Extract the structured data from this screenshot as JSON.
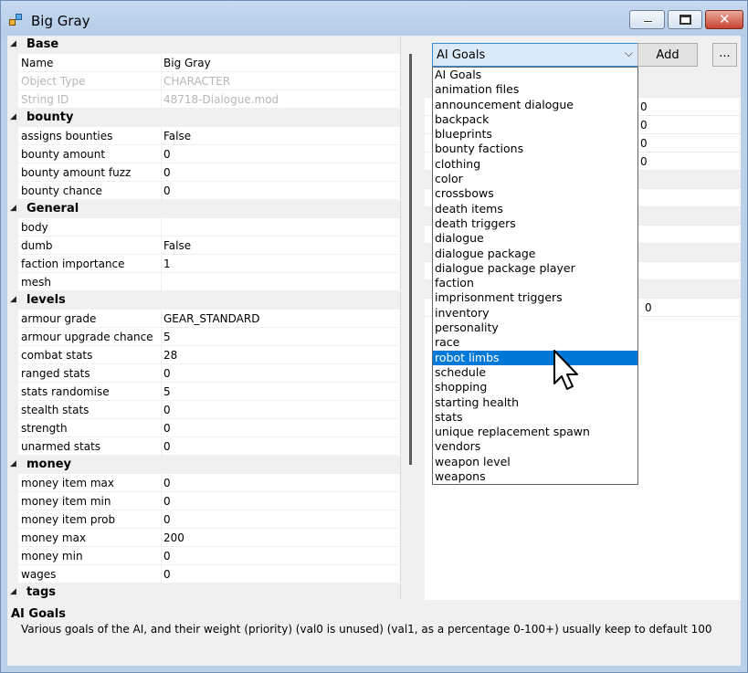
{
  "window": {
    "title": "Big Gray",
    "icon": "app-object-icon"
  },
  "grid": {
    "groups": [
      {
        "name": "Base",
        "props": [
          {
            "name": "Name",
            "value": "Big Gray",
            "disabled": false
          },
          {
            "name": "Object Type",
            "value": "CHARACTER",
            "disabled": true
          },
          {
            "name": "String ID",
            "value": "48718-Dialogue.mod",
            "disabled": true
          }
        ]
      },
      {
        "name": "bounty",
        "props": [
          {
            "name": "assigns bounties",
            "value": "False"
          },
          {
            "name": "bounty amount",
            "value": "0"
          },
          {
            "name": "bounty amount fuzz",
            "value": "0"
          },
          {
            "name": "bounty chance",
            "value": "0"
          }
        ]
      },
      {
        "name": "General",
        "props": [
          {
            "name": "body",
            "value": ""
          },
          {
            "name": "dumb",
            "value": "False"
          },
          {
            "name": "faction importance",
            "value": "1"
          },
          {
            "name": "mesh",
            "value": ""
          }
        ]
      },
      {
        "name": "levels",
        "props": [
          {
            "name": "armour grade",
            "value": "GEAR_STANDARD"
          },
          {
            "name": "armour upgrade chance",
            "value": "5"
          },
          {
            "name": "combat stats",
            "value": "28"
          },
          {
            "name": "ranged stats",
            "value": "0"
          },
          {
            "name": "stats randomise",
            "value": "5"
          },
          {
            "name": "stealth stats",
            "value": "0"
          },
          {
            "name": "strength",
            "value": "0"
          },
          {
            "name": "unarmed stats",
            "value": "0"
          }
        ]
      },
      {
        "name": "money",
        "props": [
          {
            "name": "money item max",
            "value": "0"
          },
          {
            "name": "money item min",
            "value": "0"
          },
          {
            "name": "money item prob",
            "value": "0"
          },
          {
            "name": "money max",
            "value": "200"
          },
          {
            "name": "money min",
            "value": "0"
          },
          {
            "name": "wages",
            "value": "0"
          }
        ]
      },
      {
        "name": "tags",
        "props": []
      }
    ]
  },
  "right": {
    "combo_value": "AI Goals",
    "add_label": "Add",
    "more_label": "...",
    "dropdown_selected_index": 19,
    "dropdown_items": [
      "AI Goals",
      "animation files",
      "announcement dialogue",
      "backpack",
      "blueprints",
      "bounty factions",
      "clothing",
      "color",
      "crossbows",
      "death items",
      "death triggers",
      "dialogue",
      "dialogue package",
      "dialogue package player",
      "faction",
      "imprisonment triggers",
      "inventory",
      "personality",
      "race",
      "robot limbs",
      "schedule",
      "shopping",
      "starting health",
      "stats",
      "unique replacement spawn",
      "vendors",
      "weapon level",
      "weapons"
    ],
    "visible_cells": [
      "0",
      "0",
      "0",
      "0",
      "0"
    ]
  },
  "description": {
    "title": "AI Goals",
    "text": "Various goals of the AI, and their weight (priority) (val0 is unused) (val1, as a percentage 0-100+) usually keep to default 100"
  }
}
